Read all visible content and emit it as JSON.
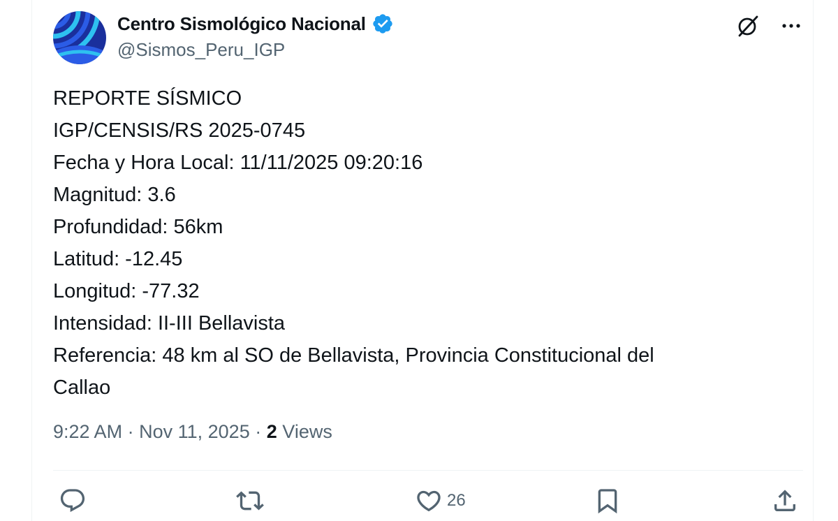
{
  "author": {
    "display_name": "Centro Sismológico Nacional",
    "handle": "@Sismos_Peru_IGP",
    "verified_color": "#1d9bf0",
    "avatar_colors": [
      "#1a2f9c",
      "#2b5ce6",
      "#2ec0f0"
    ]
  },
  "header_icons": {
    "grok": "grok-icon",
    "more": "more-icon"
  },
  "tweet": {
    "lines": [
      "REPORTE SÍSMICO",
      "IGP/CENSIS/RS 2025-0745",
      "Fecha y Hora Local: 11/11/2025 09:20:16",
      "Magnitud: 3.6",
      "Profundidad: 56km",
      "Latitud: -12.45",
      "Longitud: -77.32",
      "Intensidad: II-III Bellavista",
      "Referencia: 48 km al SO de Bellavista, Provincia Constitucional del",
      "Callao"
    ]
  },
  "meta": {
    "time": "9:22 AM",
    "separator": "·",
    "date": "Nov 11, 2025",
    "views_count": "2",
    "views_label": "Views"
  },
  "actions": {
    "reply": {
      "icon": "reply-icon",
      "count": ""
    },
    "repost": {
      "icon": "repost-icon",
      "count": ""
    },
    "like": {
      "icon": "heart-icon",
      "count": "26"
    },
    "bookmark": {
      "icon": "bookmark-icon",
      "count": ""
    },
    "share": {
      "icon": "share-icon",
      "count": ""
    }
  }
}
